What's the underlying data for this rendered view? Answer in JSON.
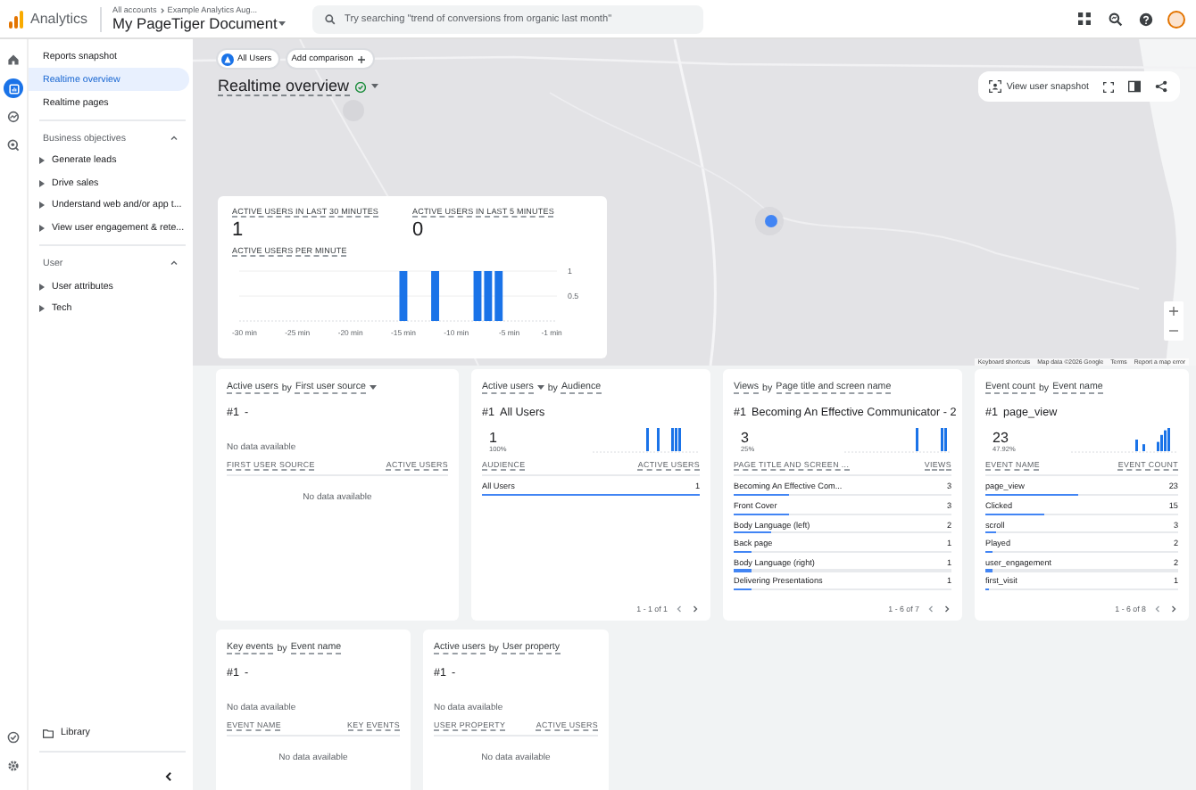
{
  "app": {
    "product": "Analytics",
    "crumbs": [
      "All accounts",
      "Example Analytics Aug..."
    ],
    "property": "My PageTiger Document"
  },
  "search": {
    "placeholder": "Try searching \"trend of conversions from organic last month\""
  },
  "rail": [
    {
      "kind": "home",
      "selected": false
    },
    {
      "kind": "reports",
      "selected": true
    },
    {
      "kind": "explore",
      "selected": false
    },
    {
      "kind": "advertising",
      "selected": false
    }
  ],
  "nav": {
    "items": [
      {
        "label": "Reports snapshot",
        "selected": false
      },
      {
        "label": "Realtime overview",
        "selected": true
      },
      {
        "label": "Realtime pages",
        "selected": false
      }
    ],
    "sections": [
      {
        "title": "Business objectives",
        "expanded": true,
        "items": [
          "Generate leads",
          "Drive sales",
          "Understand web and/or app t...",
          "View user engagement & rete..."
        ]
      },
      {
        "title": "User",
        "expanded": true,
        "items": [
          "User attributes",
          "Tech"
        ]
      }
    ],
    "library": "Library"
  },
  "chips": [
    {
      "label": "All Users",
      "kind": "segment"
    },
    {
      "label": "Add comparison",
      "kind": "add"
    }
  ],
  "page_title": "Realtime overview",
  "snapshot": "View user snapshot",
  "map_footer": [
    "Keyboard shortcuts",
    "Map data ©2026 Google",
    "Terms",
    "Report a map error"
  ],
  "realtime": {
    "metrics": [
      {
        "label": "ACTIVE USERS IN LAST 30 MINUTES",
        "value": "1"
      },
      {
        "label": "ACTIVE USERS IN LAST 5 MINUTES",
        "value": "0"
      }
    ],
    "chart_label": "ACTIVE USERS PER MINUTE",
    "chart_data": {
      "type": "bar",
      "x": [
        -30,
        -29,
        -28,
        -27,
        -26,
        -25,
        -24,
        -23,
        -22,
        -21,
        -20,
        -19,
        -18,
        -17,
        -16,
        -15,
        -14,
        -13,
        -12,
        -11,
        -10,
        -9,
        -8,
        -7,
        -6,
        -5,
        -4,
        -3,
        -2,
        -1
      ],
      "values": [
        0,
        0,
        0,
        0,
        0,
        0,
        0,
        0,
        0,
        0,
        0,
        0,
        0,
        0,
        0,
        1,
        0,
        0,
        1,
        0,
        0,
        0,
        1,
        1,
        1,
        0,
        0,
        0,
        0,
        0
      ],
      "xlim": [
        -30.5,
        -0.5
      ],
      "ylim": [
        0,
        1
      ],
      "yticks": [
        0.5,
        1
      ],
      "xticks": [
        {
          "value": -30,
          "label": "-30 min"
        },
        {
          "value": -25,
          "label": "-25 min"
        },
        {
          "value": -20,
          "label": "-20 min"
        },
        {
          "value": -15,
          "label": "-15 min"
        },
        {
          "value": -10,
          "label": "-10 min"
        },
        {
          "value": -5,
          "label": "-5 min"
        },
        {
          "value": -1,
          "label": "-1 min"
        }
      ]
    }
  },
  "cards": [
    {
      "metric": "Active users",
      "joiner": "by",
      "dimension": "First user source",
      "metric_dropdown": false,
      "dimension_dropdown": true,
      "top": "#1",
      "top_name": "-",
      "empty_chart": "No data available",
      "columns": [
        "FIRST USER SOURCE",
        "ACTIVE USERS"
      ],
      "empty_table": "No data available"
    },
    {
      "metric": "Active users",
      "joiner": "by",
      "dimension": "Audience",
      "metric_dropdown": true,
      "dimension_dropdown": false,
      "top": "#1",
      "top_name": "All Users",
      "top_value": "1",
      "top_share": "100%",
      "columns": [
        "AUDIENCE",
        "ACTIVE USERS"
      ],
      "rows": [
        {
          "name": "All Users",
          "value": "1",
          "level": 1
        }
      ],
      "pager": "1 - 1 of 1"
    },
    {
      "metric": "Views",
      "joiner": "by",
      "dimension": "Page title and screen name",
      "metric_dropdown": false,
      "dimension_dropdown": false,
      "top": "#1",
      "top_name": "Becoming An Effective Communicator - 2",
      "top_value": "3",
      "top_share": "25%",
      "columns": [
        "PAGE TITLE AND SCREEN ...",
        "VIEWS"
      ],
      "rows": [
        {
          "name": "Becoming An Effective Com...",
          "value": "3",
          "level": 0.25
        },
        {
          "name": "Front Cover",
          "value": "3",
          "level": 0.25
        },
        {
          "name": "Body Language (left)",
          "value": "2",
          "level": 0.17
        },
        {
          "name": "Back page",
          "value": "1",
          "level": 0.08
        },
        {
          "name": "Body Language (right)",
          "value": "1",
          "level": 0.08
        },
        {
          "name": "Delivering Presentations",
          "value": "1",
          "level": 0.08
        }
      ],
      "pager": "1 - 6 of 7"
    },
    {
      "metric": "Event count",
      "joiner": "by",
      "dimension": "Event name",
      "metric_dropdown": false,
      "dimension_dropdown": false,
      "top": "#1",
      "top_name": "page_view",
      "top_value": "23",
      "top_share": "47.92%",
      "columns": [
        "EVENT NAME",
        "EVENT COUNT"
      ],
      "rows": [
        {
          "name": "page_view",
          "value": "23",
          "level": 0.48
        },
        {
          "name": "Clicked",
          "value": "15",
          "level": 0.31
        },
        {
          "name": "scroll",
          "value": "3",
          "level": 0.06
        },
        {
          "name": "Played",
          "value": "2",
          "level": 0.04
        },
        {
          "name": "user_engagement",
          "value": "2",
          "level": 0.04
        },
        {
          "name": "first_visit",
          "value": "1",
          "level": 0.02
        }
      ],
      "pager": "1 - 6 of 8"
    },
    {
      "metric": "Key events",
      "joiner": "by",
      "dimension": "Event name",
      "metric_dropdown": false,
      "dimension_dropdown": false,
      "top": "#1",
      "top_name": "-",
      "empty_chart": "No data available",
      "columns": [
        "EVENT NAME",
        "KEY EVENTS"
      ],
      "empty_table": "No data available"
    },
    {
      "metric": "Active users",
      "joiner": "by",
      "dimension": "User property",
      "metric_dropdown": false,
      "dimension_dropdown": false,
      "top": "#1",
      "top_name": "-",
      "empty_chart": "No data available",
      "columns": [
        "USER PROPERTY",
        "ACTIVE USERS"
      ],
      "empty_table": "No data available"
    }
  ]
}
